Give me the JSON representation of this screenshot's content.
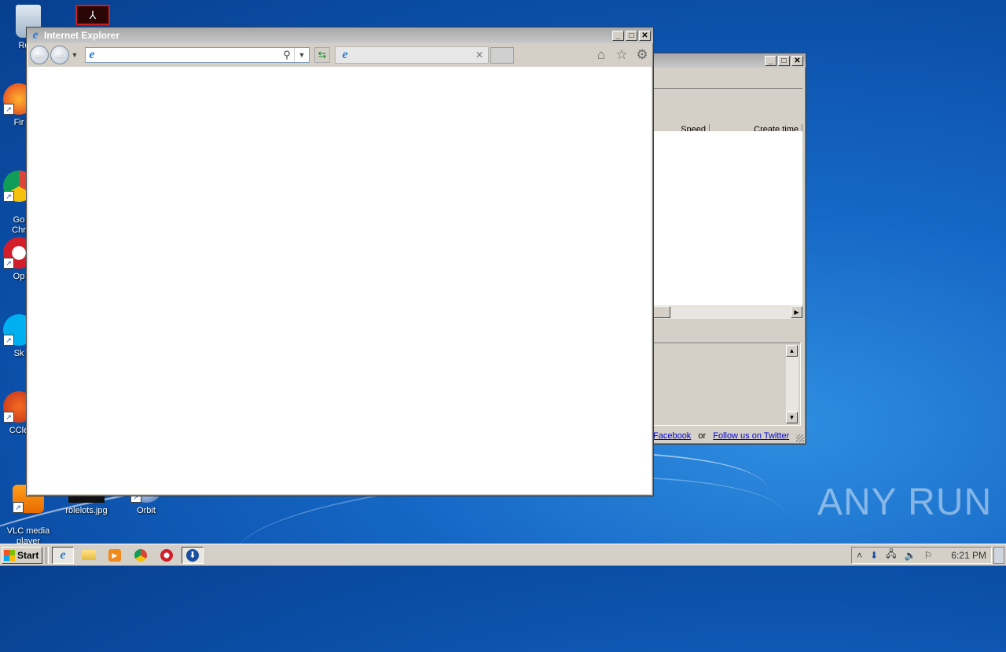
{
  "desktop": {
    "icons": [
      {
        "label": "Recy",
        "icon": "recycle-bin-icon"
      },
      {
        "label": "Fir",
        "icon": "firefox-icon"
      },
      {
        "label": "Go\nChr",
        "icon": "chrome-icon"
      },
      {
        "label": "Op",
        "icon": "opera-icon"
      },
      {
        "label": "Sk",
        "icon": "skype-icon"
      },
      {
        "label": "CCle",
        "icon": "ccleaner-icon"
      },
      {
        "label": "VLC media\nplayer",
        "icon": "vlc-icon"
      },
      {
        "label": "rolelots.jpg",
        "icon": "image-file-icon"
      },
      {
        "label": "Orbit",
        "icon": "orbit-icon"
      }
    ],
    "watermark": "ANY RUN"
  },
  "ie_window": {
    "title": "Internet Explorer",
    "address_value": "",
    "tab_title": ""
  },
  "background_window": {
    "columns": [
      "Speed",
      "Create time"
    ],
    "links": {
      "facebook": "Facebook",
      "or": "or",
      "twitter": "Follow us on Twitter"
    }
  },
  "taskbar": {
    "start_label": "Start",
    "clock": "6:21 PM",
    "apps": [
      "internet-explorer",
      "file-explorer",
      "media-player",
      "chrome",
      "opera",
      "orbit-downloader"
    ]
  }
}
